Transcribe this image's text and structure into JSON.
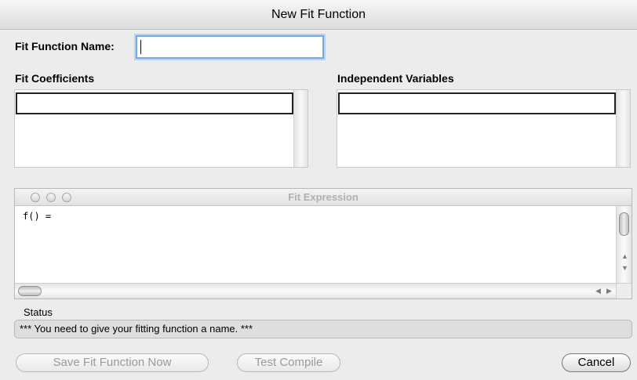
{
  "window": {
    "title": "New Fit Function"
  },
  "form": {
    "name_label": "Fit Function Name:",
    "name_value": "",
    "coefficients_label": "Fit Coefficients",
    "independent_vars_label": "Independent Variables"
  },
  "expression_panel": {
    "title": "Fit Expression",
    "text": "f() ="
  },
  "status": {
    "label": "Status",
    "message": "*** You need to give your fitting function a name. ***"
  },
  "buttons": {
    "save": "Save Fit Function Now",
    "test": "Test Compile",
    "cancel": "Cancel"
  },
  "colors": {
    "window_bg": "#ececec",
    "focus_ring": "#7aa7e0",
    "disabled_text": "#9a9a9a"
  }
}
